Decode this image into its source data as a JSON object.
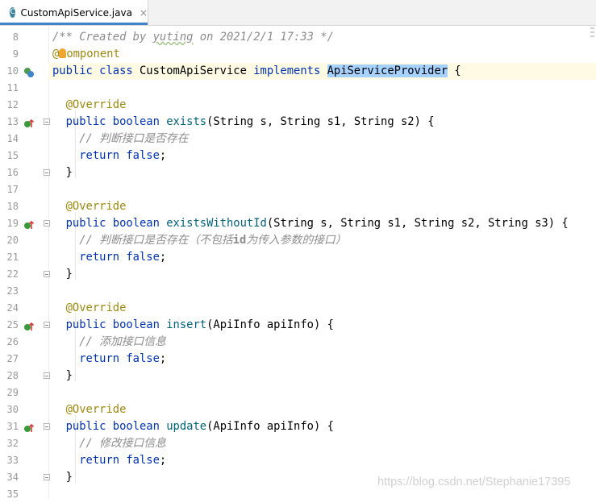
{
  "tab": {
    "icon_letter": "C",
    "filename": "CustomApiService.java",
    "close_glyph": "×"
  },
  "lines": [
    {
      "n": "8",
      "segs": [
        [
          "cmt",
          "/** Created by "
        ],
        [
          "cmt-u",
          "yuting"
        ],
        [
          "cmt",
          " on 2021/2/1 17:33 */"
        ]
      ]
    },
    {
      "n": "9",
      "segs": [
        [
          "ann",
          "@"
        ],
        [
          "bulb",
          ""
        ],
        [
          "ann",
          "omponent"
        ]
      ]
    },
    {
      "n": "10",
      "hl": true,
      "segs": [
        [
          "kw",
          "public class "
        ],
        [
          "plain",
          "CustomApiService "
        ],
        [
          "kw",
          "implements "
        ],
        [
          "sel",
          "ApiServiceProvider"
        ],
        [
          "plain",
          " {"
        ]
      ]
    },
    {
      "n": "11",
      "segs": []
    },
    {
      "n": "12",
      "segs": [
        [
          "plain",
          "  "
        ],
        [
          "ann",
          "@Override"
        ]
      ]
    },
    {
      "n": "13",
      "segs": [
        [
          "plain",
          "  "
        ],
        [
          "kw",
          "public boolean "
        ],
        [
          "fn",
          "exists"
        ],
        [
          "plain",
          "(String s, String s1, String s2) {"
        ]
      ]
    },
    {
      "n": "14",
      "segs": [
        [
          "plain",
          "    "
        ],
        [
          "cmt",
          "// 判断接口是否存在"
        ]
      ]
    },
    {
      "n": "15",
      "segs": [
        [
          "plain",
          "    "
        ],
        [
          "kw",
          "return false"
        ],
        [
          "plain",
          ";"
        ]
      ]
    },
    {
      "n": "16",
      "segs": [
        [
          "plain",
          "  }"
        ]
      ]
    },
    {
      "n": "17",
      "segs": []
    },
    {
      "n": "18",
      "segs": [
        [
          "plain",
          "  "
        ],
        [
          "ann",
          "@Override"
        ]
      ]
    },
    {
      "n": "19",
      "segs": [
        [
          "plain",
          "  "
        ],
        [
          "kw",
          "public boolean "
        ],
        [
          "fn",
          "existsWithoutId"
        ],
        [
          "plain",
          "(String s, String s1, String s2, String s3) {"
        ]
      ]
    },
    {
      "n": "20",
      "segs": [
        [
          "plain",
          "    "
        ],
        [
          "cmt",
          "// 判断接口是否存在（不包括"
        ],
        [
          "cmt-b",
          "id"
        ],
        [
          "cmt",
          "为传入参数的接口）"
        ]
      ]
    },
    {
      "n": "21",
      "segs": [
        [
          "plain",
          "    "
        ],
        [
          "kw",
          "return false"
        ],
        [
          "plain",
          ";"
        ]
      ]
    },
    {
      "n": "22",
      "segs": [
        [
          "plain",
          "  }"
        ]
      ]
    },
    {
      "n": "23",
      "segs": []
    },
    {
      "n": "24",
      "segs": [
        [
          "plain",
          "  "
        ],
        [
          "ann",
          "@Override"
        ]
      ]
    },
    {
      "n": "25",
      "segs": [
        [
          "plain",
          "  "
        ],
        [
          "kw",
          "public boolean "
        ],
        [
          "fn",
          "insert"
        ],
        [
          "plain",
          "(ApiInfo apiInfo) {"
        ]
      ]
    },
    {
      "n": "26",
      "segs": [
        [
          "plain",
          "    "
        ],
        [
          "cmt",
          "// 添加接口信息"
        ]
      ]
    },
    {
      "n": "27",
      "segs": [
        [
          "plain",
          "    "
        ],
        [
          "kw",
          "return false"
        ],
        [
          "plain",
          ";"
        ]
      ]
    },
    {
      "n": "28",
      "segs": [
        [
          "plain",
          "  }"
        ]
      ]
    },
    {
      "n": "29",
      "segs": []
    },
    {
      "n": "30",
      "segs": [
        [
          "plain",
          "  "
        ],
        [
          "ann",
          "@Override"
        ]
      ]
    },
    {
      "n": "31",
      "segs": [
        [
          "plain",
          "  "
        ],
        [
          "kw",
          "public boolean "
        ],
        [
          "fn",
          "update"
        ],
        [
          "plain",
          "(ApiInfo apiInfo) {"
        ]
      ]
    },
    {
      "n": "32",
      "segs": [
        [
          "plain",
          "    "
        ],
        [
          "cmt",
          "// 修改接口信息"
        ]
      ]
    },
    {
      "n": "33",
      "segs": [
        [
          "plain",
          "    "
        ],
        [
          "kw",
          "return false"
        ],
        [
          "plain",
          ";"
        ]
      ]
    },
    {
      "n": "34",
      "segs": [
        [
          "plain",
          "  }"
        ]
      ]
    },
    {
      "n": "35",
      "segs": []
    }
  ],
  "gutter_marks": {
    "10": "class-impl-icon",
    "13": "override-method-icon",
    "19": "override-method-icon",
    "25": "override-method-icon",
    "31": "override-method-icon"
  },
  "fold_lines": [
    "13",
    "16",
    "19",
    "22",
    "25",
    "28",
    "31",
    "34"
  ],
  "watermark": "https://blog.csdn.net/Stephanie17395",
  "colors": {
    "keyword": "#0033b3",
    "annotation": "#9e880d",
    "comment": "#8c8c8c",
    "selection": "#a6d2ff",
    "tab_accent": "#4083c9"
  }
}
